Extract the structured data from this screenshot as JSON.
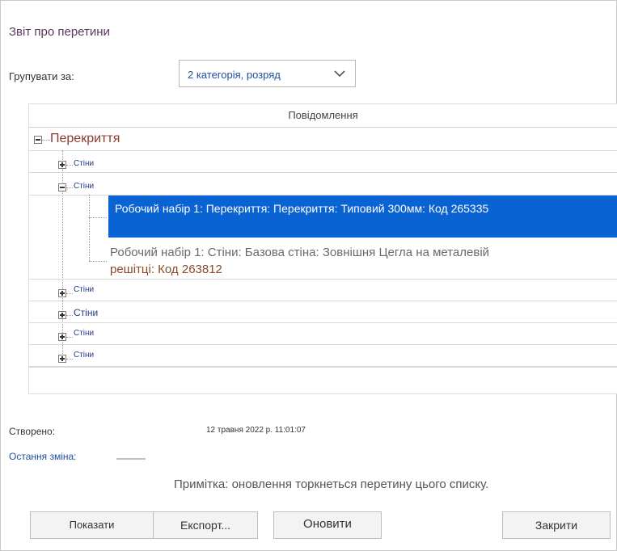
{
  "window": {
    "title": "Звіт про перетини"
  },
  "grouping": {
    "label": "Групувати за:",
    "selected": "2 категорія, розряд"
  },
  "table": {
    "header": "Повідомлення",
    "root": {
      "label": "Перекриття",
      "state": "expanded"
    },
    "groups": [
      {
        "label": "Стіни",
        "state": "collapsed"
      },
      {
        "label": "Стіни",
        "state": "expanded"
      },
      {
        "label": "Стіни",
        "state": "collapsed"
      },
      {
        "label": "Стіни",
        "state": "collapsed"
      },
      {
        "label": "Стіни",
        "state": "collapsed"
      },
      {
        "label": "Стіни",
        "state": "collapsed"
      }
    ],
    "items": [
      {
        "text": "Робочий набір 1: Перекриття: Перекриття: Типовий 300мм: Код 265335",
        "selected": true
      },
      {
        "text_line1": "Робочий набір 1: Стіни: Базова стіна: Зовнішня Цегла на металевій",
        "text_line2": "решітці: Код 263812",
        "selected": false
      }
    ]
  },
  "meta": {
    "created_label": "Створено:",
    "created_value": "12 травня 2022 р. 11:01:07",
    "modified_label": "Остання зміна:"
  },
  "note": "Примітка: оновлення торкнеться перетину цього списку.",
  "buttons": {
    "show": "Показати",
    "export": "Експорт...",
    "refresh": "Оновити",
    "close": "Закрити"
  },
  "colors": {
    "selection": "#0a63d3",
    "title": "#5a3a5e",
    "link": "#1f4fa0",
    "root": "#8b3a2e"
  },
  "icons": {
    "dropdown": "chevron-down-icon",
    "expand": "plus-box-icon",
    "collapse": "minus-box-icon"
  }
}
